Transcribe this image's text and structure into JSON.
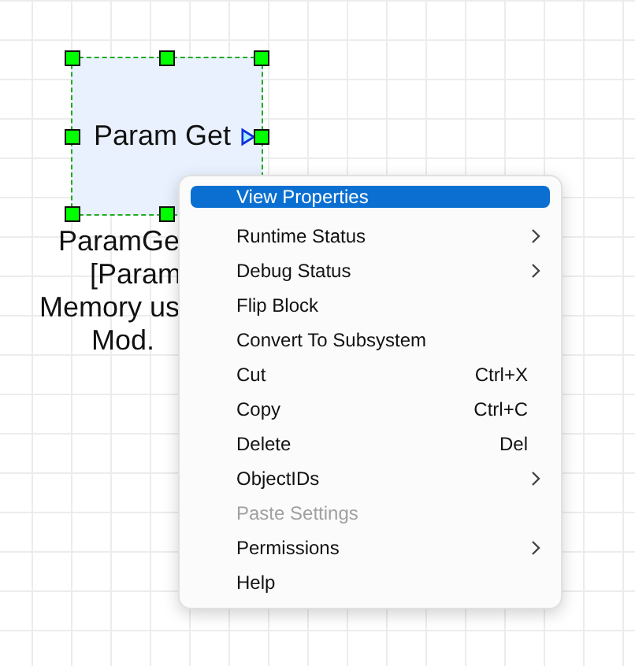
{
  "block": {
    "title": "Param Get",
    "selected": true,
    "label_lines": [
      "ParamGe",
      "[Param",
      "Memory us",
      "Mod."
    ]
  },
  "context_menu": {
    "items": [
      {
        "label": "View Properties",
        "selected": true,
        "disabled": false,
        "submenu": false
      },
      {
        "label": "Runtime Status",
        "selected": false,
        "disabled": false,
        "submenu": true
      },
      {
        "label": "Debug Status",
        "selected": false,
        "disabled": false,
        "submenu": true
      },
      {
        "label": "Flip Block",
        "selected": false,
        "disabled": false,
        "submenu": false
      },
      {
        "label": "Convert To Subsystem",
        "selected": false,
        "disabled": false,
        "submenu": false
      },
      {
        "label": "Cut",
        "shortcut": "Ctrl+X",
        "selected": false,
        "disabled": false,
        "submenu": false
      },
      {
        "label": "Copy",
        "shortcut": "Ctrl+C",
        "selected": false,
        "disabled": false,
        "submenu": false
      },
      {
        "label": "Delete",
        "shortcut": "Del",
        "selected": false,
        "disabled": false,
        "submenu": false
      },
      {
        "label": "ObjectIDs",
        "selected": false,
        "disabled": false,
        "submenu": true
      },
      {
        "label": "Paste Settings",
        "selected": false,
        "disabled": true,
        "submenu": false
      },
      {
        "label": "Permissions",
        "selected": false,
        "disabled": false,
        "submenu": true
      },
      {
        "label": "Help",
        "selected": false,
        "disabled": false,
        "submenu": false
      }
    ]
  }
}
